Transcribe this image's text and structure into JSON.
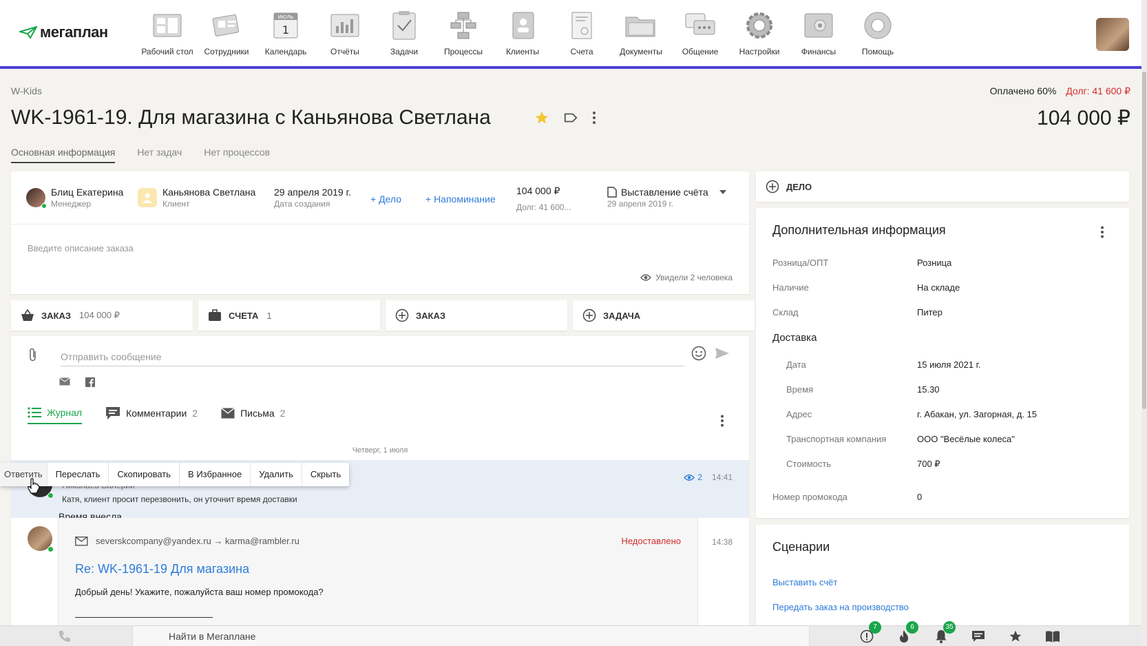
{
  "app": {
    "logo_text": "мегаплан",
    "nav": [
      {
        "label": "Рабочий стол",
        "icon": "desktop-icon"
      },
      {
        "label": "Сотрудники",
        "icon": "employees-icon"
      },
      {
        "label": "Календарь",
        "icon": "calendar-icon",
        "cal_month": "ИЮЛЬ",
        "cal_day": "1"
      },
      {
        "label": "Отчёты",
        "icon": "reports-icon"
      },
      {
        "label": "Задачи",
        "icon": "tasks-icon"
      },
      {
        "label": "Процессы",
        "icon": "processes-icon"
      },
      {
        "label": "Клиенты",
        "icon": "clients-icon"
      },
      {
        "label": "Счета",
        "icon": "invoices-icon"
      },
      {
        "label": "Документы",
        "icon": "documents-icon"
      },
      {
        "label": "Общение",
        "icon": "communication-icon"
      },
      {
        "label": "Настройки",
        "icon": "settings-icon"
      },
      {
        "label": "Финансы",
        "icon": "finance-icon"
      },
      {
        "label": "Помощь",
        "icon": "help-icon"
      }
    ]
  },
  "header": {
    "company": "W-Kids",
    "paid": "Оплачено 60%",
    "debt": "Долг: 41 600 ₽",
    "title": "WK-1961-19. Для магазина с Каньянова Светлана",
    "amount": "104 000 ₽"
  },
  "tabs": [
    {
      "label": "Основная информация",
      "active": true
    },
    {
      "label": "Нет задач",
      "active": false
    },
    {
      "label": "Нет процессов",
      "active": false
    }
  ],
  "info": {
    "manager_name": "Блиц Екатерина",
    "manager_role": "Менеджер",
    "client_name": "Каньянова Светлана",
    "client_role": "Клиент",
    "created_date": "29 апреля 2019 г.",
    "created_label": "Дата создания",
    "add_deal": "+ Дело",
    "add_reminder": "+ Напоминание",
    "sum": "104 000 ₽",
    "sum_debt": "Долг: 41 600...",
    "stage": "Выставление счёта",
    "stage_date": "29 апреля 2019 г.",
    "description_placeholder": "Введите описание заказа",
    "seen": "Увидели 2 человека"
  },
  "buttons": {
    "order_label": "ЗАКАЗ",
    "order_sum": "104 000 ₽",
    "invoices_label": "СЧЕТА",
    "invoices_count": "1",
    "add_order": "ЗАКАЗ",
    "add_task": "ЗАДАЧА"
  },
  "messages": {
    "input_placeholder": "Отправить сообщение",
    "tabs": [
      {
        "label": "Журнал",
        "count": "",
        "active": true
      },
      {
        "label": "Комментарии",
        "count": "2",
        "active": false
      },
      {
        "label": "Письма",
        "count": "2",
        "active": false
      }
    ],
    "date_separator": "Четверг, 1 июля",
    "log": {
      "author": "Николаев Валерий",
      "text": "Катя, клиент просит перезвонить, он уточнит время доставки",
      "sub": "Время внесла",
      "views": "2",
      "time": "14:41"
    },
    "mail": {
      "addr": "severskcompany@yandex.ru → karma@rambler.ru",
      "status": "Недоставлено",
      "subject": "Re: WK-1961-19 Для магазина",
      "body": "Добрый день! Укажите, пожалуйста ваш номер промокода?",
      "time": "14:38"
    }
  },
  "context_menu": [
    "Ответить",
    "Переслать",
    "Скопировать",
    "В Избранное",
    "Удалить",
    "Скрыть"
  ],
  "right": {
    "delo_label": "ДЕЛО",
    "addinfo_title": "Дополнительная информация",
    "fields": [
      {
        "label": "Розница/ОПТ",
        "value": "Розница"
      },
      {
        "label": "Наличие",
        "value": "На складе"
      },
      {
        "label": "Склад",
        "value": "Питер"
      }
    ],
    "delivery_title": "Доставка",
    "delivery": [
      {
        "label": "Дата",
        "value": "15 июля 2021 г."
      },
      {
        "label": "Время",
        "value": "15.30"
      },
      {
        "label": "Адрес",
        "value": "г. Абакан, ул. Загорная, д. 15"
      },
      {
        "label": "Транспортная компания",
        "value": "ООО \"Весёлые колеса\""
      },
      {
        "label": "Стоимость",
        "value": "700 ₽"
      }
    ],
    "promo_label": "Номер промокода",
    "promo_value": "0",
    "scenarios_title": "Сценарии",
    "scenarios": [
      "Выставить счёт",
      "Передать заказ на производство"
    ]
  },
  "bottom": {
    "search_placeholder": "Найти в Мегаплане",
    "badges": {
      "alerts": "7",
      "fire": "6",
      "notifications": "35"
    }
  },
  "colors": {
    "accent": "#4b3fd6",
    "link": "#2f7cd8",
    "green": "#1aa54b",
    "danger": "#d62b2b"
  }
}
